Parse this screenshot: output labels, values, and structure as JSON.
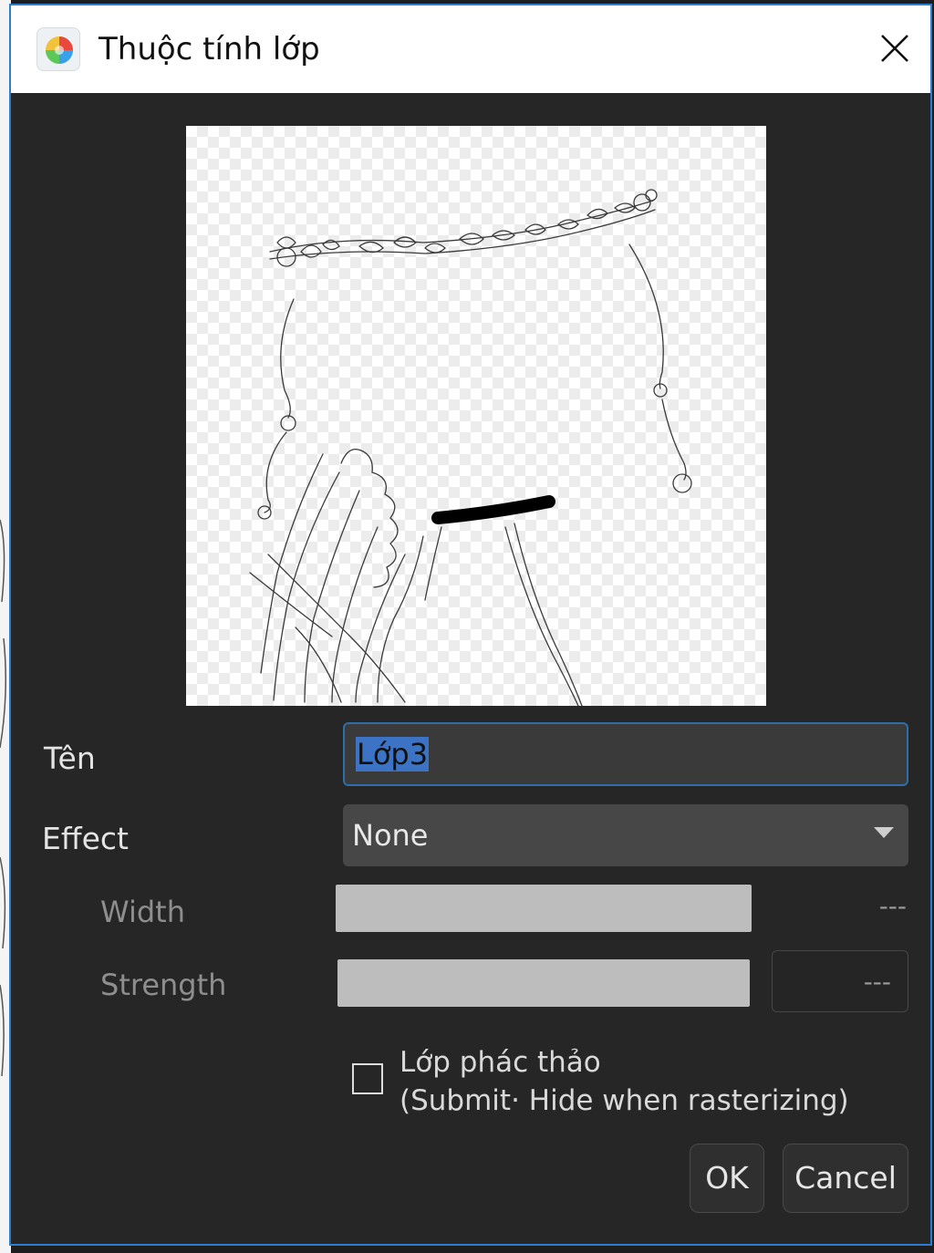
{
  "dialog": {
    "title": "Thuộc tính lớp",
    "app_icon": "color-wheel-icon",
    "close_icon": "close-icon"
  },
  "preview": {
    "kind": "layer thumbnail",
    "alt": "line art sketch on transparent checkerboard"
  },
  "fields": {
    "name_label": "Tên",
    "name_value": "Lớp3",
    "effect_label": "Effect",
    "effect_value": "None",
    "width_label": "Width",
    "width_value": "---",
    "strength_label": "Strength",
    "strength_value": "---"
  },
  "draft": {
    "checked": false,
    "line1": "Lớp phác thảo",
    "line2": "(Submit· Hide when rasterizing)"
  },
  "buttons": {
    "ok": "OK",
    "cancel": "Cancel"
  },
  "colors": {
    "accent": "#2c7fd0",
    "dialog_bg": "#262626",
    "selection": "#3d73c4"
  }
}
